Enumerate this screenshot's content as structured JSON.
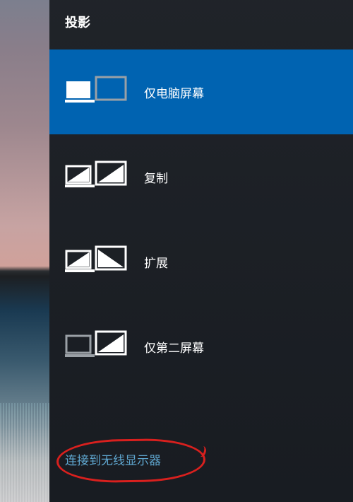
{
  "panel": {
    "title": "投影",
    "options": [
      {
        "id": "pc-only",
        "label": "仅电脑屏幕",
        "selected": true
      },
      {
        "id": "duplicate",
        "label": "复制",
        "selected": false
      },
      {
        "id": "extend",
        "label": "扩展",
        "selected": false
      },
      {
        "id": "second-only",
        "label": "仅第二屏幕",
        "selected": false
      }
    ],
    "wireless_link": "连接到无线显示器"
  }
}
